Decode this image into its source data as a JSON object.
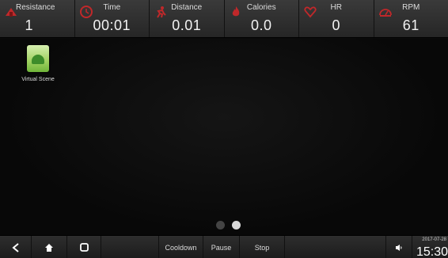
{
  "metrics": [
    {
      "label": "Resistance",
      "value": "1",
      "icon": "resistance-icon"
    },
    {
      "label": "Time",
      "value": "00:01",
      "icon": "clock-icon"
    },
    {
      "label": "Distance",
      "value": "0.01",
      "icon": "runner-icon"
    },
    {
      "label": "Calories",
      "value": "0.0",
      "icon": "flame-icon"
    },
    {
      "label": "HR",
      "value": "0",
      "icon": "heart-icon"
    },
    {
      "label": "RPM",
      "value": "61",
      "icon": "speedometer-icon"
    }
  ],
  "desktop": {
    "apps": [
      {
        "label": "Virtual Scene",
        "icon": "android-app-icon"
      }
    ],
    "page_indicator": {
      "pages": 2,
      "current": 2
    }
  },
  "navbar": {
    "cooldown_label": "Cooldown",
    "pause_label": "Pause",
    "stop_label": "Stop",
    "date": "2017-07-28",
    "time": "15:30"
  },
  "colors": {
    "icon_accent": "#c0282a",
    "bar_bg": "#2a2a2a"
  }
}
